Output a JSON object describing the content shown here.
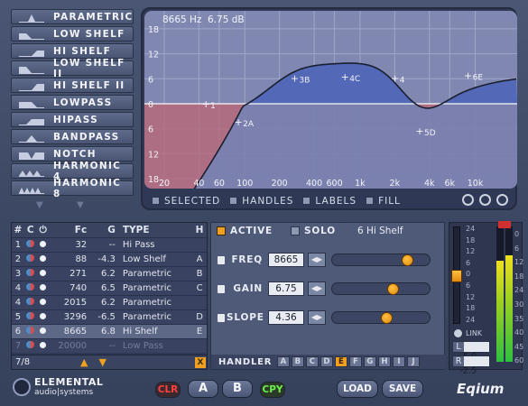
{
  "filters": [
    "PARAMETRIC",
    "LOW SHELF",
    "HI SHELF",
    "LOW SHELF II",
    "HI SHELF II",
    "LOWPASS",
    "HIPASS",
    "BANDPASS",
    "NOTCH",
    "HARMONIC 4",
    "HARMONIC 8"
  ],
  "graph": {
    "readout_freq": "8665 Hz",
    "readout_gain": "6.75 dB",
    "db_labels": [
      "18",
      "12",
      "6",
      "0",
      "6",
      "12",
      "18"
    ],
    "freq_labels": [
      "20",
      "40",
      "60",
      "100",
      "200",
      "400",
      "600",
      "1k",
      "2k",
      "4k",
      "6k",
      "10k"
    ],
    "handle_labels": [
      "1",
      "2A",
      "3B",
      "4C",
      "4",
      "5D",
      "6E"
    ],
    "options": [
      "SELECTED",
      "HANDLES",
      "LABELS",
      "FILL"
    ],
    "colors": {
      "curve_fill": "#7a7fae",
      "peak_blue": "#4660b8",
      "cut_red": "#b86878",
      "curve": "#f4f4f8"
    }
  },
  "table": {
    "headers": {
      "num": "#",
      "c": "C",
      "power": "⏻",
      "fc": "Fc",
      "g": "G",
      "type": "TYPE",
      "h": "H"
    },
    "rows": [
      {
        "n": "1",
        "fc": "32",
        "g": "--",
        "type": "Hi Pass",
        "h": ""
      },
      {
        "n": "2",
        "fc": "88",
        "g": "-4.3",
        "type": "Low Shelf",
        "h": "A"
      },
      {
        "n": "3",
        "fc": "271",
        "g": "6.2",
        "type": "Parametric",
        "h": "B"
      },
      {
        "n": "4",
        "fc": "740",
        "g": "6.5",
        "type": "Parametric",
        "h": "C"
      },
      {
        "n": "4",
        "fc": "2015",
        "g": "6.2",
        "type": "Parametric",
        "h": ""
      },
      {
        "n": "5",
        "fc": "3296",
        "g": "-6.5",
        "type": "Parametric",
        "h": "D"
      },
      {
        "n": "6",
        "fc": "8665",
        "g": "6.8",
        "type": "Hi Shelf",
        "h": "E"
      },
      {
        "n": "7",
        "fc": "20000",
        "g": "--",
        "type": "Low Pass",
        "h": ""
      }
    ],
    "footer_count": "7/8",
    "close_label": "X"
  },
  "control": {
    "active_label": "ACTIVE",
    "solo_label": "SOLO",
    "band_name": "6 Hi Shelf",
    "params": [
      {
        "label": "FREQ",
        "value": "8665",
        "slider": 0.8
      },
      {
        "label": "GAIN",
        "value": "6.75",
        "slider": 0.64
      },
      {
        "label": "SLOPE",
        "value": "4.36",
        "slider": 0.56
      }
    ],
    "handler_label": "HANDLER",
    "handlers": [
      "A",
      "B",
      "C",
      "D",
      "E",
      "F",
      "G",
      "H",
      "I",
      "J"
    ],
    "active_handler": "E"
  },
  "meter": {
    "left_scale": [
      "24",
      "18",
      "12",
      "6",
      "0",
      "6",
      "12",
      "18",
      "24"
    ],
    "right_scale": [
      "0",
      "6",
      "12",
      "18",
      "24",
      "30",
      "35",
      "40",
      "45",
      "60"
    ],
    "link_label": "LINK",
    "l_label": "L",
    "l_value": "-5.0",
    "r_label": "R",
    "r_value": "-2.5"
  },
  "bottom": {
    "brand_top": "ELEMENTAL",
    "brand_bottom": "audio|systems",
    "clr": "CLR",
    "a": "A",
    "b": "B",
    "cpy": "CPY",
    "load": "LOAD",
    "save": "SAVE",
    "product": "Eqium"
  }
}
